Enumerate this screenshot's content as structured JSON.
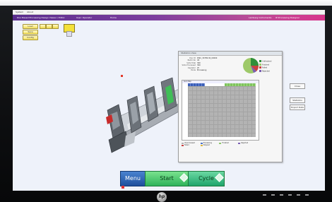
{
  "window": {
    "menu": [
      "System",
      "About"
    ],
    "app_title": "Disc Based Processing Design Viewer / Editor",
    "user": "User: Operator",
    "mode": "Home",
    "brand": "Lamberg Instruments",
    "right_text": "IP Processing Designer"
  },
  "toolbar": {
    "buttons": [
      "Load",
      "Save",
      "Config",
      "Run",
      "Run"
    ]
  },
  "panel": {
    "title": "Statistics View",
    "info": [
      {
        "label": "Disc ID",
        "value": "DISC_34789 00_00000"
      },
      {
        "label": "Batch No",
        "value": "45"
      },
      {
        "label": "Slots Total",
        "value": "300"
      },
      {
        "label": "Slots Processed",
        "value": "300"
      },
      {
        "label": "Operator",
        "value": "JH"
      },
      {
        "label": "Mode",
        "value": "Processing"
      }
    ],
    "pie_legend": [
      {
        "label": "Unfinished",
        "color": "#2f8f3a"
      },
      {
        "label": "Finished",
        "color": "#9ec969"
      },
      {
        "label": "Failed",
        "color": "#c94141"
      },
      {
        "label": "Rejected",
        "color": "#7a5fb3"
      }
    ],
    "grid_title": "Slot Map",
    "grid_legend": [
      {
        "label": "Unprocessed",
        "color": "#b3b3b3"
      },
      {
        "label": "Processing",
        "color": "#4e74c9"
      },
      {
        "label": "Finished",
        "color": "#8cc66b"
      },
      {
        "label": "Rejected",
        "color": "#7a5fb3"
      },
      {
        "label": "Failed",
        "color": "#c94141"
      },
      {
        "label": "Skipped",
        "color": "#e0b93f"
      }
    ],
    "buttons": [
      "Close",
      "Statistics",
      "Export Data"
    ]
  },
  "bottom": {
    "menu": "Menu",
    "start": "Start",
    "cycle": "Cycle"
  },
  "monitor": {
    "logo": "hp"
  }
}
